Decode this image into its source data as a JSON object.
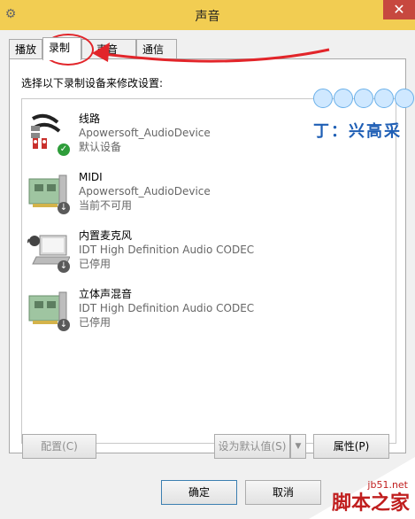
{
  "window": {
    "title": "声音",
    "close_glyph": "✕"
  },
  "tabs": [
    {
      "label": "播放",
      "active": false
    },
    {
      "label": "录制",
      "active": true
    },
    {
      "label": "声音",
      "active": false
    },
    {
      "label": "通信",
      "active": false
    }
  ],
  "panel": {
    "instruction": "选择以下录制设备来修改设置:"
  },
  "devices": [
    {
      "name": "线路",
      "description": "Apowersoft_AudioDevice",
      "status": "默认设备",
      "icon": "line-in-icon",
      "badge": "check"
    },
    {
      "name": "MIDI",
      "description": "Apowersoft_AudioDevice",
      "status": "当前不可用",
      "icon": "sound-card-icon",
      "badge": "down"
    },
    {
      "name": "内置麦克风",
      "description": "IDT High Definition Audio CODEC",
      "status": "已停用",
      "icon": "laptop-microphone-icon",
      "badge": "down"
    },
    {
      "name": "立体声混音",
      "description": "IDT High Definition Audio CODEC",
      "status": "已停用",
      "icon": "sound-card-icon",
      "badge": "down"
    }
  ],
  "buttons": {
    "configure": "配置(C)",
    "set_default": "设为默认值(S)",
    "properties": "属性(P)",
    "ok": "确定",
    "cancel": "取消"
  },
  "watermark": {
    "text": "丁：兴高采"
  },
  "corner": {
    "url": "jb51.net",
    "site_name": "脚本之家"
  },
  "colors": {
    "title_bar": "#f2cd52",
    "close_button": "#c7483f",
    "annotation_red": "#e2252a",
    "check_badge": "#2e9d3a"
  }
}
